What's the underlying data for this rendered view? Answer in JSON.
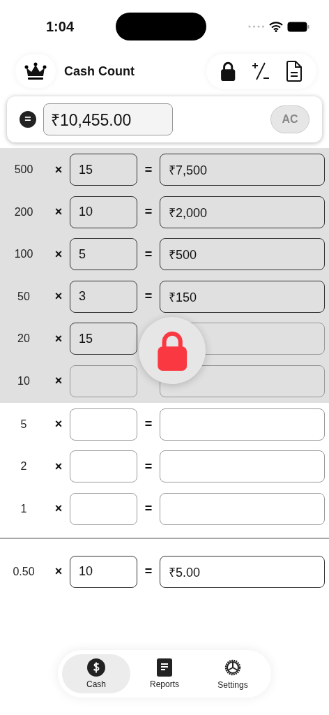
{
  "status_bar": {
    "time": "1:04"
  },
  "header": {
    "title": "Cash Count"
  },
  "total": {
    "operator": "=",
    "value": "₹10,455.00",
    "clear_label": "AC"
  },
  "sections": [
    {
      "locked": true,
      "rows": [
        {
          "label": "500",
          "times": "×",
          "quantity": "15",
          "equals": "=",
          "amount": "₹7,500"
        },
        {
          "label": "200",
          "times": "×",
          "quantity": "10",
          "equals": "=",
          "amount": "₹2,000"
        },
        {
          "label": "100",
          "times": "×",
          "quantity": "5",
          "equals": "=",
          "amount": "₹500"
        },
        {
          "label": "50",
          "times": "×",
          "quantity": "3",
          "equals": "=",
          "amount": "₹150"
        },
        {
          "label": "20",
          "times": "×",
          "quantity": "15"
        },
        {
          "label": "10",
          "times": "×"
        }
      ]
    },
    {
      "locked": false,
      "rows": [
        {
          "label": "5",
          "times": "×",
          "equals": "="
        },
        {
          "label": "2",
          "times": "×",
          "equals": "="
        },
        {
          "label": "1",
          "times": "×",
          "equals": "="
        }
      ]
    },
    {
      "locked": false,
      "divider": true,
      "rows": [
        {
          "label": "0.50",
          "times": "×",
          "quantity": "10",
          "equals": "=",
          "amount": "₹5.00"
        }
      ]
    }
  ],
  "tabs": [
    {
      "label": "Cash",
      "kind": "cash",
      "selected": true
    },
    {
      "label": "Reports",
      "kind": "reports",
      "selected": false
    },
    {
      "label": "Settings",
      "kind": "settings",
      "selected": false
    }
  ]
}
